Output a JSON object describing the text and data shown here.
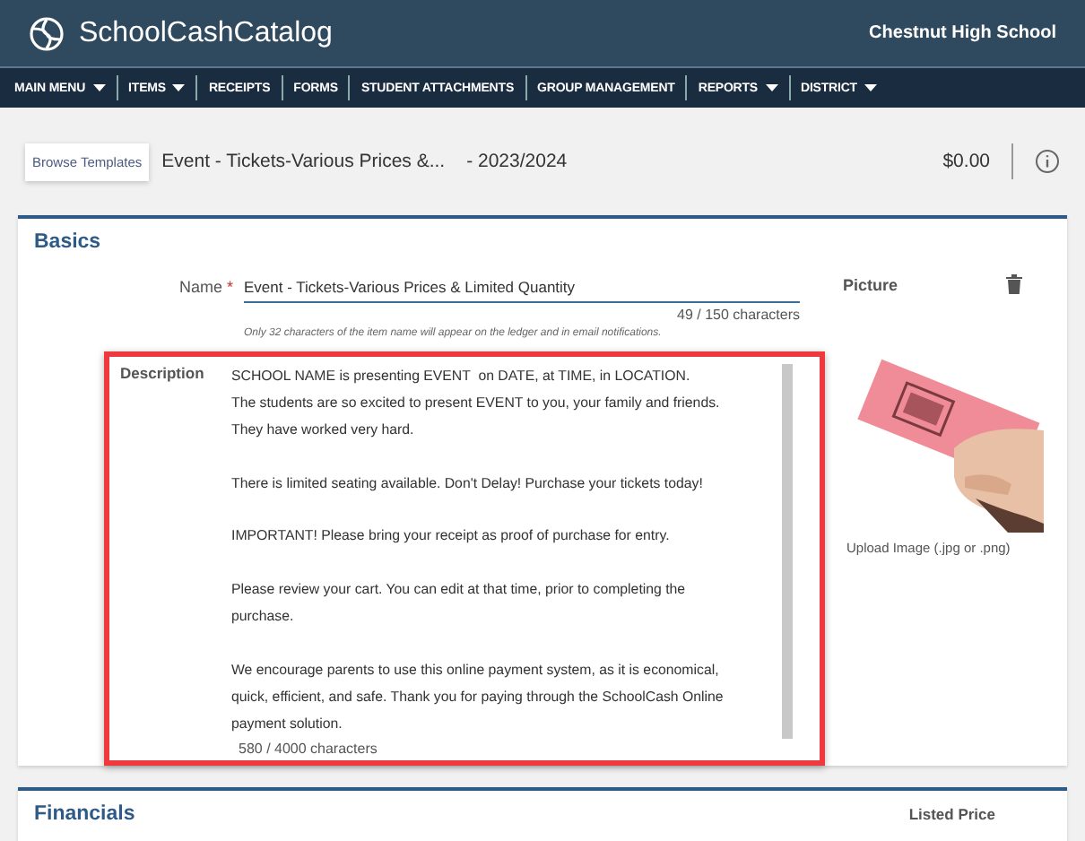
{
  "header": {
    "app_name": "SchoolCashCatalog",
    "school": "Chestnut High School"
  },
  "nav": [
    {
      "label": "MAIN MENU",
      "dropdown": true
    },
    {
      "label": "ITEMS",
      "dropdown": true
    },
    {
      "label": "RECEIPTS",
      "dropdown": false
    },
    {
      "label": "FORMS",
      "dropdown": false
    },
    {
      "label": "STUDENT ATTACHMENTS",
      "dropdown": false
    },
    {
      "label": "GROUP MANAGEMENT",
      "dropdown": false
    },
    {
      "label": "REPORTS",
      "dropdown": true
    },
    {
      "label": "DISTRICT",
      "dropdown": true
    }
  ],
  "toolbar": {
    "button": "Browse Templates",
    "item_title": "Event - Tickets-Various Prices &...",
    "year": "- 2023/2024",
    "total": "$0.00"
  },
  "basics": {
    "title": "Basics",
    "name_label": "Name",
    "required_mark": "*",
    "name_value": "Event - Tickets-Various Prices & Limited Quantity",
    "name_count": "49 / 150  characters",
    "name_hint": "Only 32 characters of the item name will appear on the ledger and in email notifications.",
    "description_label": "Description",
    "description_value": "SCHOOL NAME is presenting EVENT  on DATE, at TIME, in LOCATION.\nThe students are so excited to present EVENT to you, your family and friends.\nThey have worked very hard.\n\nThere is limited seating available. Don't Delay! Purchase your tickets today!\n\nIMPORTANT! Please bring your receipt as proof of purchase for entry.\n\nPlease review your cart. You can edit at that time, prior to completing the\npurchase.\n\nWe encourage parents to use this online payment system, as it is economical,\nquick, efficient, and safe. Thank you for paying through the SchoolCash Online\npayment solution.",
    "description_count": "580 / 4000  characters",
    "highlighted": true,
    "picture_label": "Picture",
    "upload_label": "Upload Image (.jpg or .png)"
  },
  "financials": {
    "title": "Financials",
    "listed_price": "Listed Price"
  }
}
